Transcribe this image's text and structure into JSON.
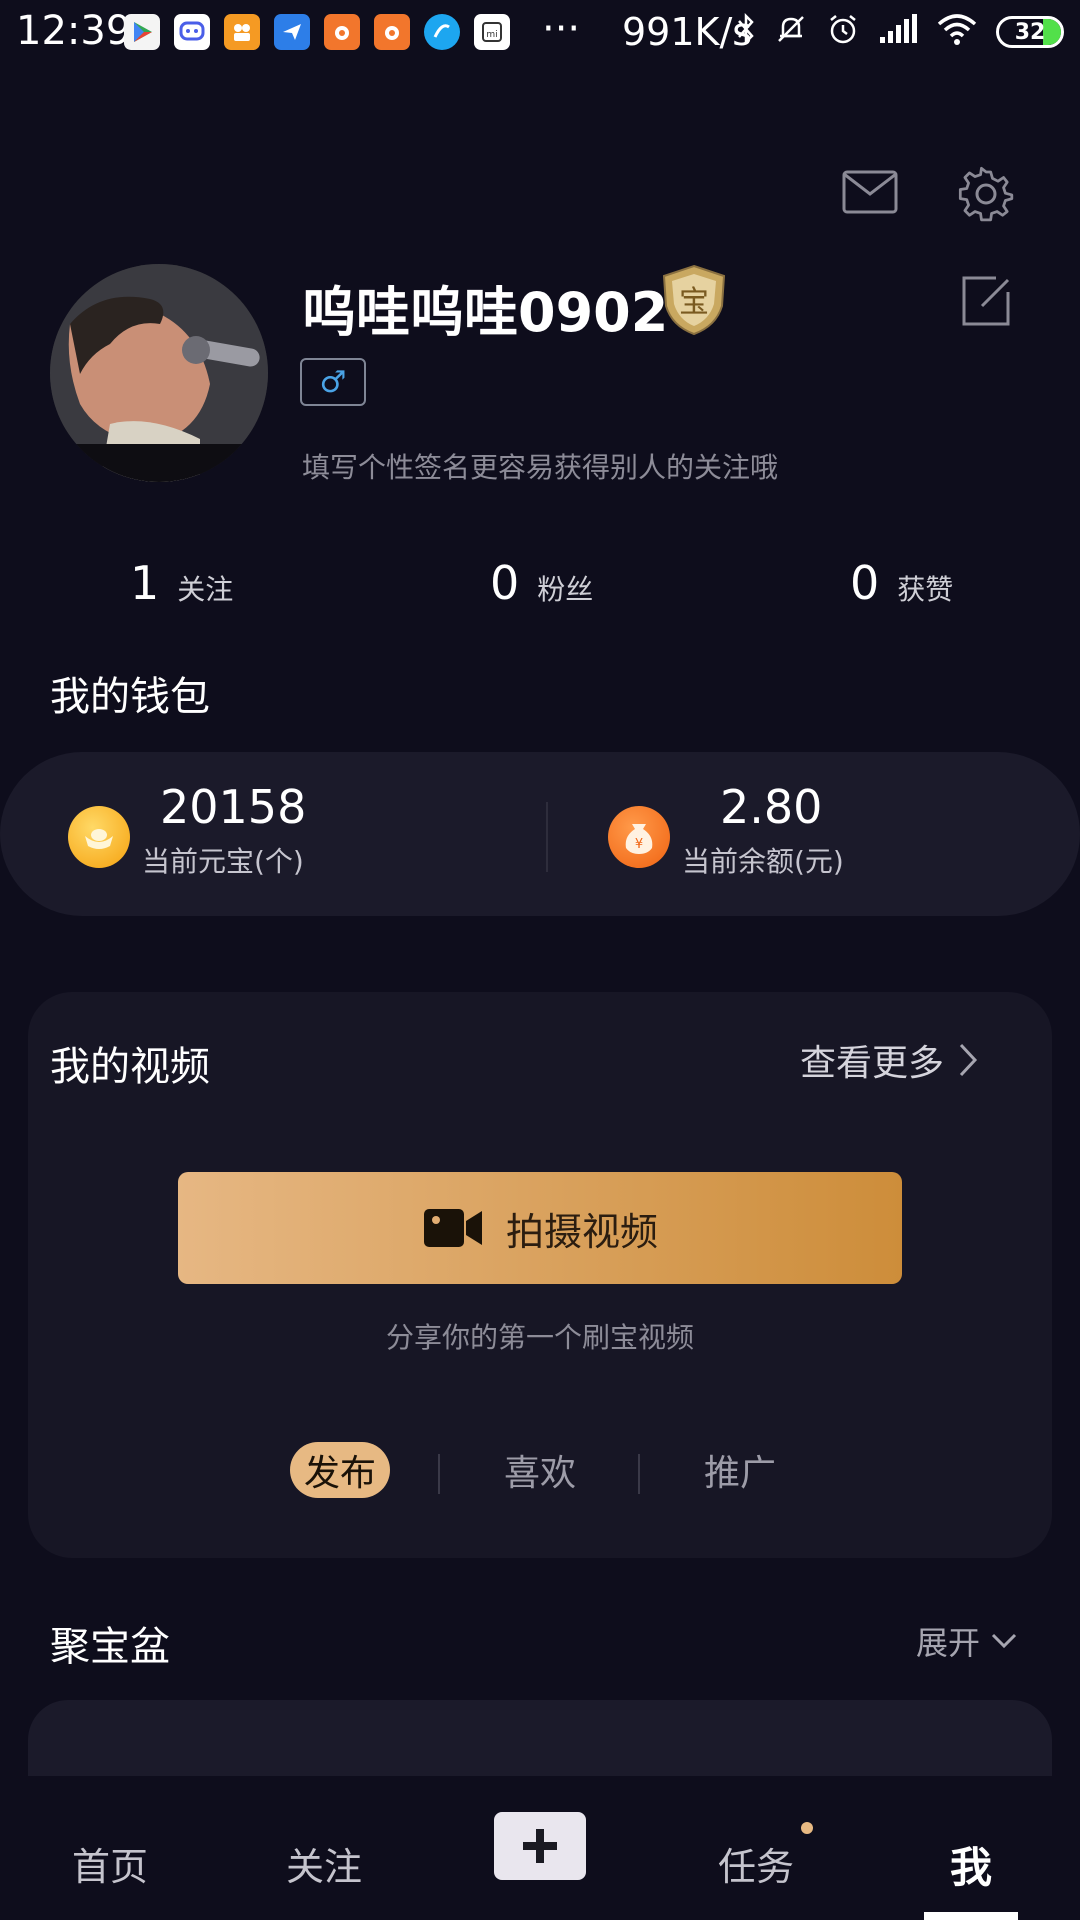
{
  "status_bar": {
    "time": "12:39",
    "more": "···",
    "net_speed": "991K/s",
    "battery": "32",
    "notification_icons": [
      "play-store-icon",
      "message-icon",
      "video-app-icon",
      "bird-app-icon",
      "squirrel-app-icon",
      "squirrel-app-icon-2",
      "blue-app-icon",
      "mi-icon"
    ],
    "system_icons": [
      "bluetooth-icon",
      "mute-icon",
      "alarm-icon",
      "signal-icon",
      "wifi-icon"
    ]
  },
  "header": {
    "icons": [
      "mail-icon",
      "gear-icon"
    ]
  },
  "profile": {
    "username": "呜哇呜哇0902",
    "badge_char": "宝",
    "gender_symbol": "♂",
    "signature": "填写个性签名更容易获得别人的关注哦",
    "edit_icon": "edit-icon"
  },
  "stats": [
    {
      "value": "1",
      "label": "关注"
    },
    {
      "value": "0",
      "label": "粉丝"
    },
    {
      "value": "0",
      "label": "获赞"
    }
  ],
  "wallet": {
    "title": "我的钱包",
    "ingots": {
      "value": "20158",
      "label": "当前元宝(个)"
    },
    "balance": {
      "value": "2.80",
      "label": "当前余额(元)",
      "icon_char": "¥"
    }
  },
  "videos": {
    "title": "我的视频",
    "view_more": "查看更多",
    "shoot_label": "拍摄视频",
    "hint": "分享你的第一个刷宝视频",
    "tabs": [
      {
        "label": "发布",
        "active": true
      },
      {
        "label": "喜欢",
        "active": false
      },
      {
        "label": "推广",
        "active": false
      }
    ]
  },
  "jubaopen": {
    "title": "聚宝盆",
    "expand_label": "展开"
  },
  "bottom_nav": {
    "items": [
      {
        "label": "首页"
      },
      {
        "label": "关注"
      },
      {
        "label": "任务"
      },
      {
        "label": "我"
      }
    ],
    "active": "我"
  },
  "colors": {
    "background": "#0e0d1c",
    "accent_gold": "#e7b983",
    "card": "#171625"
  }
}
